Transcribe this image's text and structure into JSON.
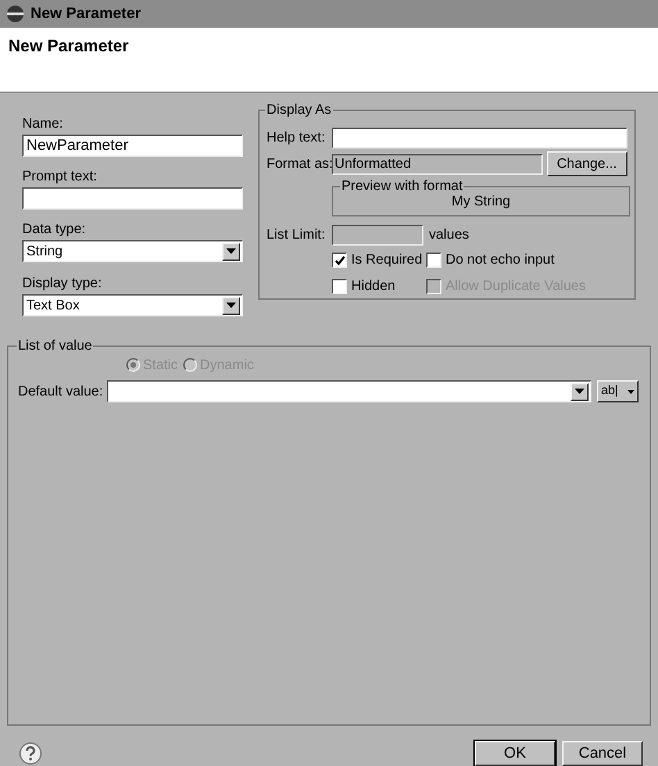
{
  "window": {
    "title": "New Parameter"
  },
  "banner": {
    "title": "New Parameter"
  },
  "left_fields": [
    {
      "kind": "text",
      "label": "Name:",
      "value": "NewParameter"
    },
    {
      "kind": "text",
      "label": "Prompt text:"
    },
    {
      "kind": "select",
      "label": "Data type:",
      "value": "String"
    },
    {
      "kind": "select",
      "label": "Display type:",
      "value": "Text Box"
    }
  ],
  "display_as": {
    "title": "Display As",
    "help_text_label": "Help text:",
    "format_label": "Format as:",
    "format_value": "Unformatted",
    "change_button": "Change...",
    "preview_title": "Preview with format",
    "preview_value": "My String",
    "list_limit_label": "List Limit:",
    "list_limit_suffix": "values",
    "checkboxes": [
      {
        "label": "Is Required",
        "checked": true,
        "disabled": false
      },
      {
        "label": "Do not echo input",
        "checked": false,
        "disabled": false
      },
      {
        "label": "Hidden",
        "checked": false,
        "disabled": false
      },
      {
        "label": "Allow Duplicate Values",
        "checked": false,
        "disabled": true
      }
    ]
  },
  "list_of_value": {
    "title": "List of value",
    "radios": [
      {
        "label": "Static",
        "selected": true,
        "disabled": true
      },
      {
        "label": "Dynamic",
        "selected": false,
        "disabled": true
      }
    ],
    "default_label": "Default value:",
    "expression_button": "ab|"
  },
  "buttons": [
    {
      "label": "OK",
      "default": true
    },
    {
      "label": "Cancel",
      "default": false
    }
  ]
}
